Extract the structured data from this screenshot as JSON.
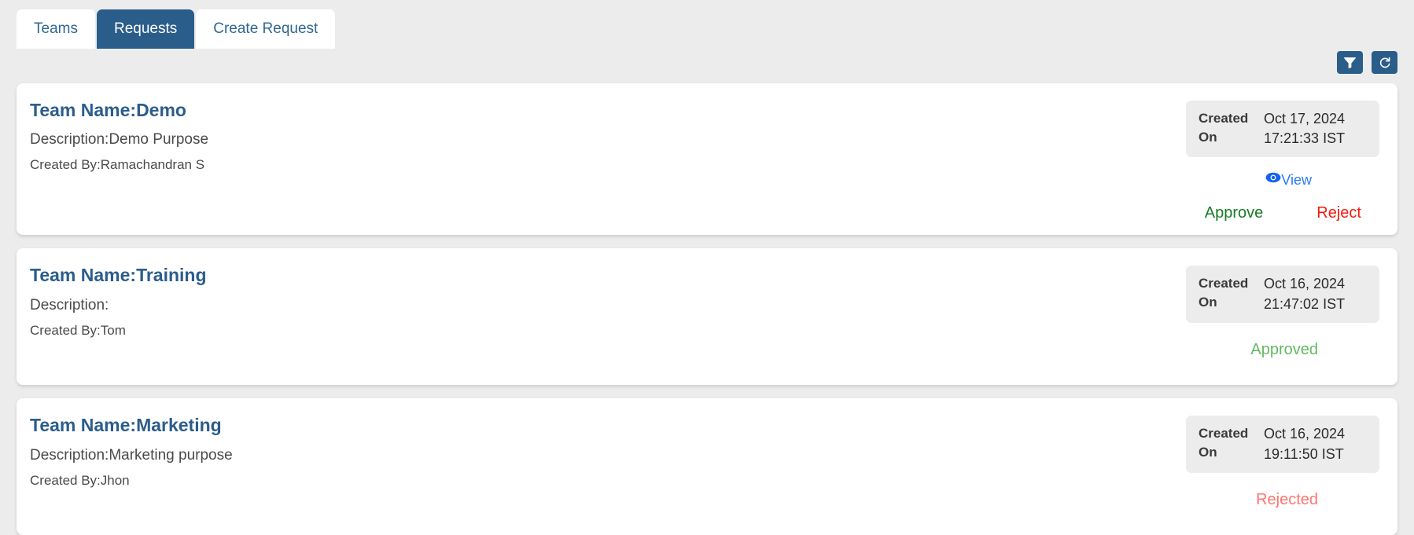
{
  "tabs": [
    {
      "label": "Teams",
      "active": false
    },
    {
      "label": "Requests",
      "active": true
    },
    {
      "label": "Create Request",
      "active": false
    }
  ],
  "toolbar": {
    "filter_icon": "filter-icon",
    "refresh_icon": "refresh-icon"
  },
  "colors": {
    "primary": "#2b5d8b",
    "link": "#2a7bf7",
    "approve": "#157a24",
    "reject": "#f31a0c",
    "approved_status": "#63b863",
    "rejected_status": "#fd7470",
    "page_background": "#ececed",
    "card_background": "#ffffff",
    "date_box_background": "#ececec"
  },
  "labels": {
    "created_on": "Created On",
    "view": "View",
    "approve": "Approve",
    "reject": "Reject"
  },
  "requests": [
    {
      "team_name": "Team Name:Demo",
      "description": "Description:Demo Purpose",
      "created_by": "Created By:Ramachandran S",
      "created_on_label": "Created On",
      "created_date": "Oct 17, 2024",
      "created_time": "17:21:33 IST",
      "state": "pending",
      "view_label": "View",
      "approve_label": "Approve",
      "reject_label": "Reject"
    },
    {
      "team_name": "Team Name:Training",
      "description": "Description:",
      "created_by": "Created By:Tom",
      "created_on_label": "Created On",
      "created_date": "Oct 16, 2024",
      "created_time": "21:47:02 IST",
      "state": "approved",
      "status_label": "Approved"
    },
    {
      "team_name": "Team Name:Marketing",
      "description": "Description:Marketing purpose",
      "created_by": "Created By:Jhon",
      "created_on_label": "Created On",
      "created_date": "Oct 16, 2024",
      "created_time": "19:11:50 IST",
      "state": "rejected",
      "status_label": "Rejected"
    }
  ]
}
